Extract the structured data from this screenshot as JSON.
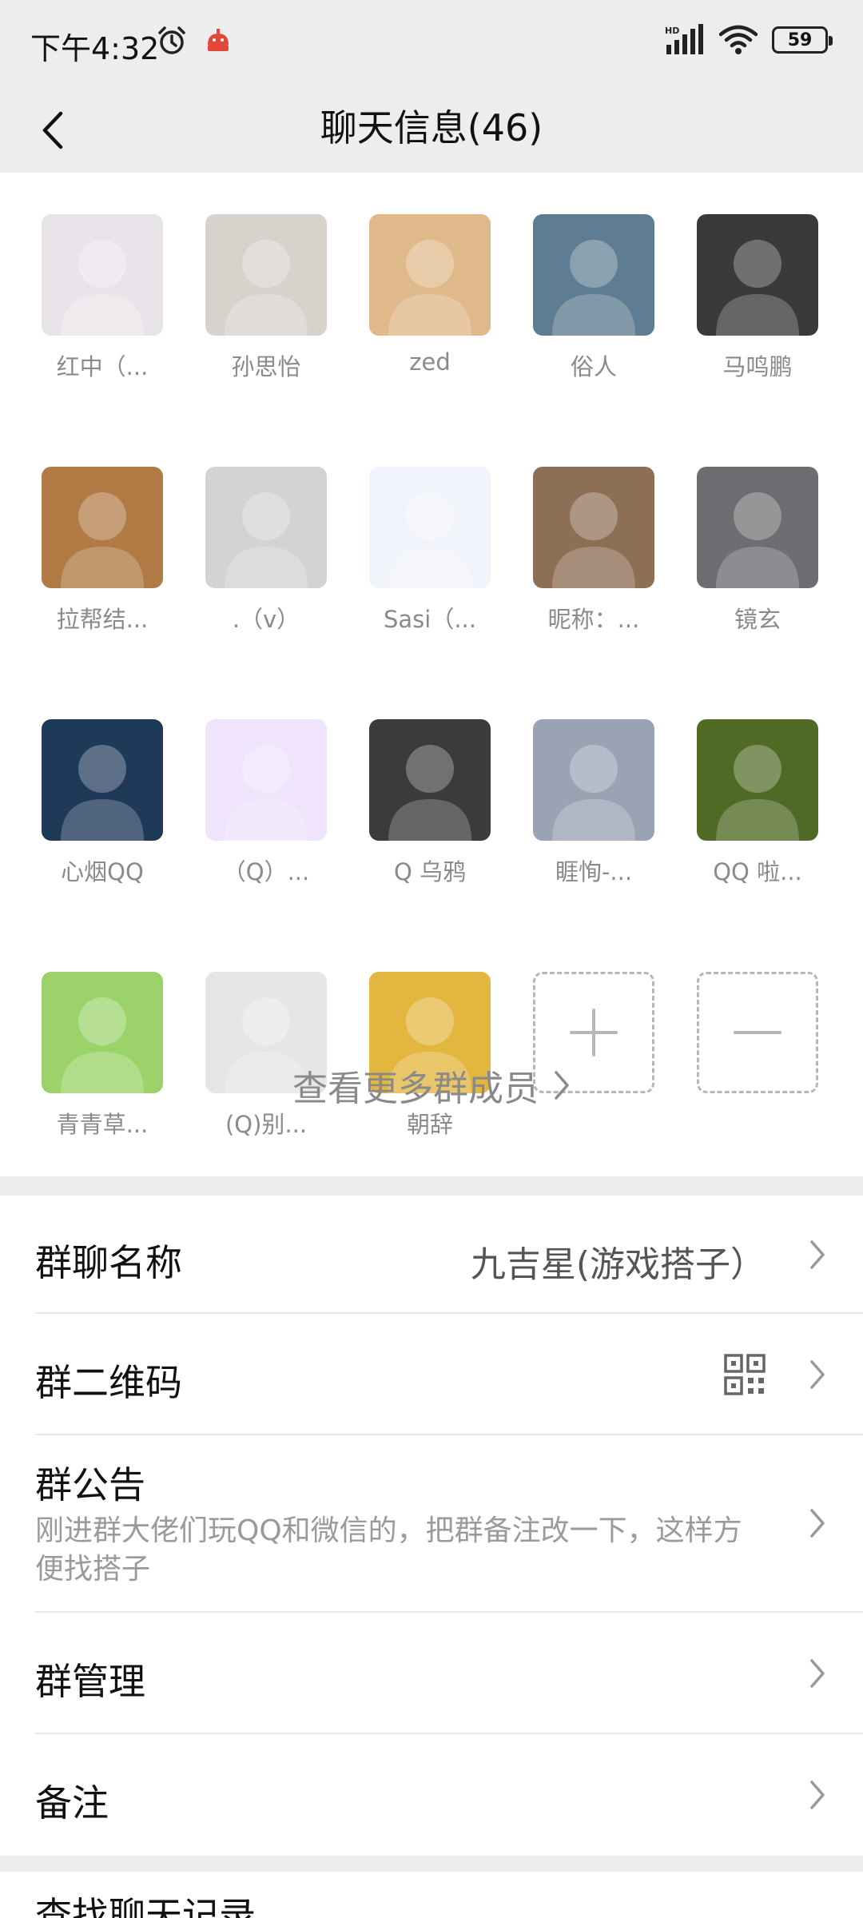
{
  "status_bar": {
    "time": "下午4:32",
    "battery": "59",
    "network_label": "HD"
  },
  "header": {
    "title": "聊天信息(46)"
  },
  "members": [
    {
      "name": "红中（...",
      "avatar_color": "#e9e4ea"
    },
    {
      "name": "孙思怡",
      "avatar_color": "#d8d2cc"
    },
    {
      "name": "zed",
      "avatar_color": "#e0b98a"
    },
    {
      "name": "俗人",
      "avatar_color": "#5f7d92"
    },
    {
      "name": "马鸣鹏",
      "avatar_color": "#3a3a3c"
    },
    {
      "name": "拉帮结...",
      "avatar_color": "#b07b45"
    },
    {
      "name": ".（v）",
      "avatar_color": "#d3d3d3"
    },
    {
      "name": "Sasi（...",
      "avatar_color": "#f2f4fb"
    },
    {
      "name": "昵称：...",
      "avatar_color": "#8d6f55"
    },
    {
      "name": "镜玄",
      "avatar_color": "#6e6e72"
    },
    {
      "name": "心烟QQ",
      "avatar_color": "#1f3a59"
    },
    {
      "name": "（Q）...",
      "avatar_color": "#efe4fb"
    },
    {
      "name": "Q 乌鸦",
      "avatar_color": "#3b3b3b"
    },
    {
      "name": "睚恂-...",
      "avatar_color": "#9aa3b4"
    },
    {
      "name": "QQ 啦...",
      "avatar_color": "#4f6a24"
    },
    {
      "name": "青青草...",
      "avatar_color": "#9bd36a"
    },
    {
      "name": "(Q)别...",
      "avatar_color": "#e6e6e6"
    },
    {
      "name": "朝辞",
      "avatar_color": "#e3b63f"
    }
  ],
  "actions": {
    "add_icon": "plus-icon",
    "remove_icon": "minus-icon"
  },
  "view_more": "查看更多群成员",
  "settings": {
    "group_name_label": "群聊名称",
    "group_name_value": "九吉星(游戏搭子）",
    "qr_label": "群二维码",
    "notice_label": "群公告",
    "notice_text": "刚进群大佬们玩QQ和微信的，把群备注改一下，这样方便找搭子",
    "manage_label": "群管理",
    "remark_label": "备注"
  },
  "bottom_partial_label": "查找聊天记录"
}
